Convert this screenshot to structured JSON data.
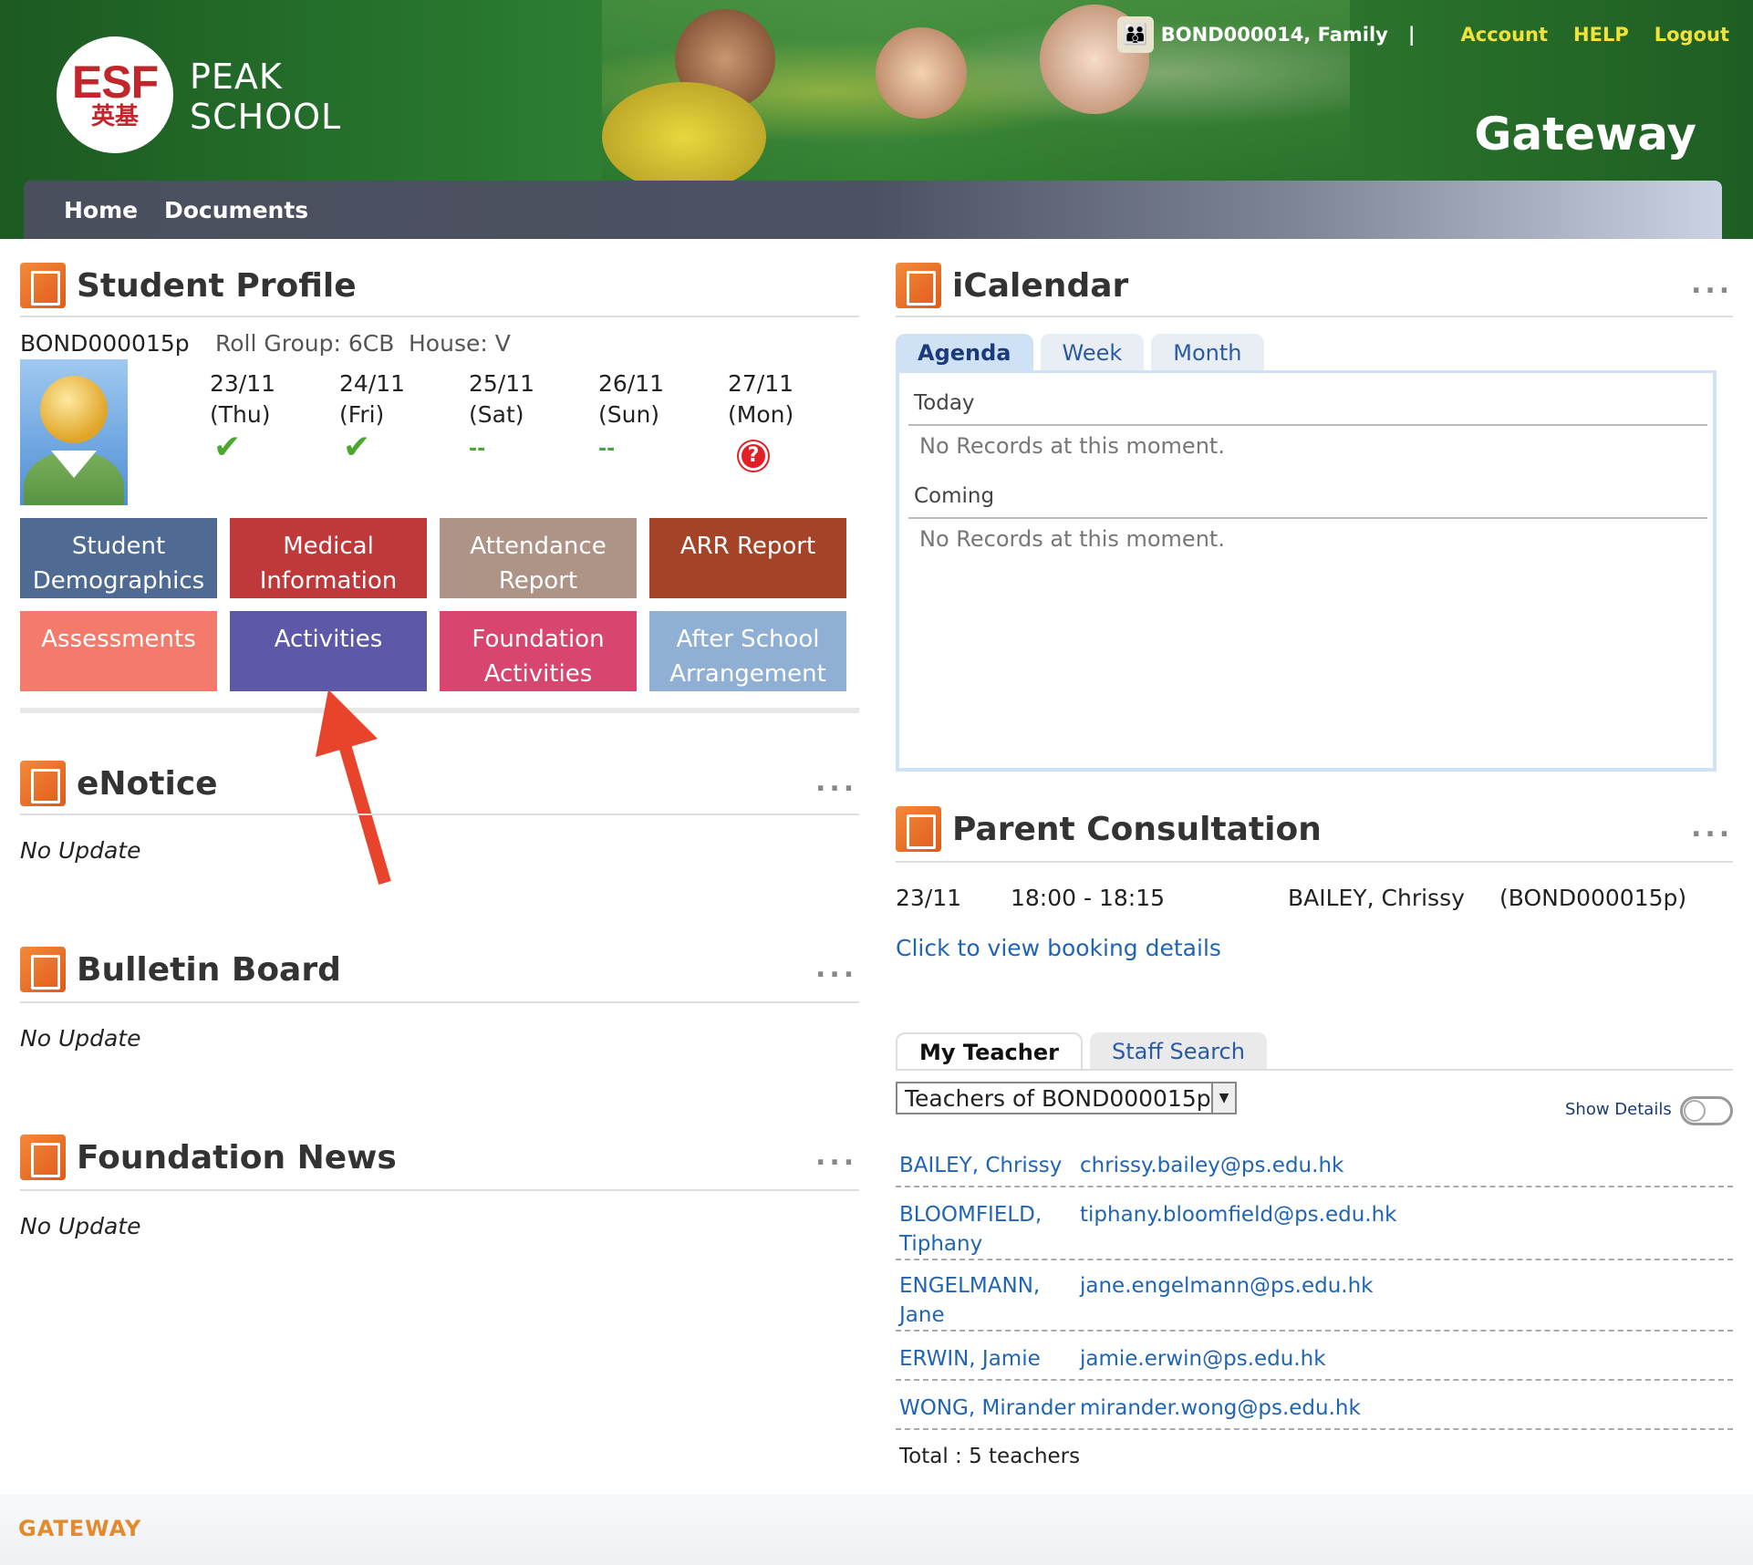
{
  "header": {
    "logo_esf": "ESF",
    "logo_cn": "英基",
    "school_line1": "PEAK",
    "school_line2": "SCHOOL",
    "portal_title": "Gateway",
    "user_name": "BOND000014, Family",
    "separator": "|",
    "links": {
      "account": "Account",
      "help": "HELP",
      "logout": "Logout"
    }
  },
  "nav": {
    "home": "Home",
    "documents": "Documents"
  },
  "student_profile": {
    "title": "Student Profile",
    "student_id": "BOND000015p",
    "roll_group": "Roll Group: 6CB",
    "house": "House: V",
    "days": [
      {
        "date": "23/11",
        "dow": "(Thu)",
        "status": "present"
      },
      {
        "date": "24/11",
        "dow": "(Fri)",
        "status": "present"
      },
      {
        "date": "25/11",
        "dow": "(Sat)",
        "status": "--"
      },
      {
        "date": "26/11",
        "dow": "(Sun)",
        "status": "--"
      },
      {
        "date": "27/11",
        "dow": "(Mon)",
        "status": "unknown"
      }
    ],
    "tiles": [
      {
        "label": "Student Demographics",
        "color": "#4f6b94"
      },
      {
        "label": "Medical Information",
        "color": "#c0393a"
      },
      {
        "label": "Attendance Report",
        "color": "#ae9486"
      },
      {
        "label": "ARR Report",
        "color": "#a44328"
      },
      {
        "label": "Assessments",
        "color": "#f47a6c"
      },
      {
        "label": "Activities",
        "color": "#5e58a8"
      },
      {
        "label": "Foundation Activities",
        "color": "#d8456e"
      },
      {
        "label": "After School Arrangement",
        "color": "#8fb0d4"
      }
    ]
  },
  "enotice": {
    "title": "eNotice",
    "more": "...",
    "content": "No Update"
  },
  "bulletin": {
    "title": "Bulletin Board",
    "more": "...",
    "content": "No Update"
  },
  "foundation_news": {
    "title": "Foundation News",
    "more": "...",
    "content": "No Update"
  },
  "icalendar": {
    "title": "iCalendar",
    "more": "...",
    "tabs": [
      "Agenda",
      "Week",
      "Month"
    ],
    "active_tab": "Agenda",
    "today_label": "Today",
    "today_content": "No Records at this moment.",
    "coming_label": "Coming",
    "coming_content": "No Records at this moment."
  },
  "parent_consultation": {
    "title": "Parent Consultation",
    "more": "...",
    "date": "23/11",
    "time": "18:00 - 18:15",
    "teacher": "BAILEY, Chrissy",
    "student": "(BOND000015p)",
    "link": "Click to view booking details"
  },
  "teachers": {
    "tabs": [
      "My Teacher",
      "Staff Search"
    ],
    "select_value": "Teachers of BOND000015p",
    "show_details": "Show Details",
    "rows": [
      {
        "name": "BAILEY, Chrissy",
        "email": "chrissy.bailey@ps.edu.hk"
      },
      {
        "name": "BLOOMFIELD, Tiphany",
        "email": "tiphany.bloomfield@ps.edu.hk"
      },
      {
        "name": "ENGELMANN, Jane",
        "email": "jane.engelmann@ps.edu.hk"
      },
      {
        "name": "ERWIN, Jamie",
        "email": "jamie.erwin@ps.edu.hk"
      },
      {
        "name": "WONG, Mirander",
        "email": "mirander.wong@ps.edu.hk"
      }
    ],
    "total": "Total : 5 teachers"
  },
  "footer": {
    "label": "GATEWAY"
  },
  "colors": {
    "accent_green": "#2a7a30",
    "link_blue": "#2064b4",
    "yellow_link": "#f3e23a"
  }
}
